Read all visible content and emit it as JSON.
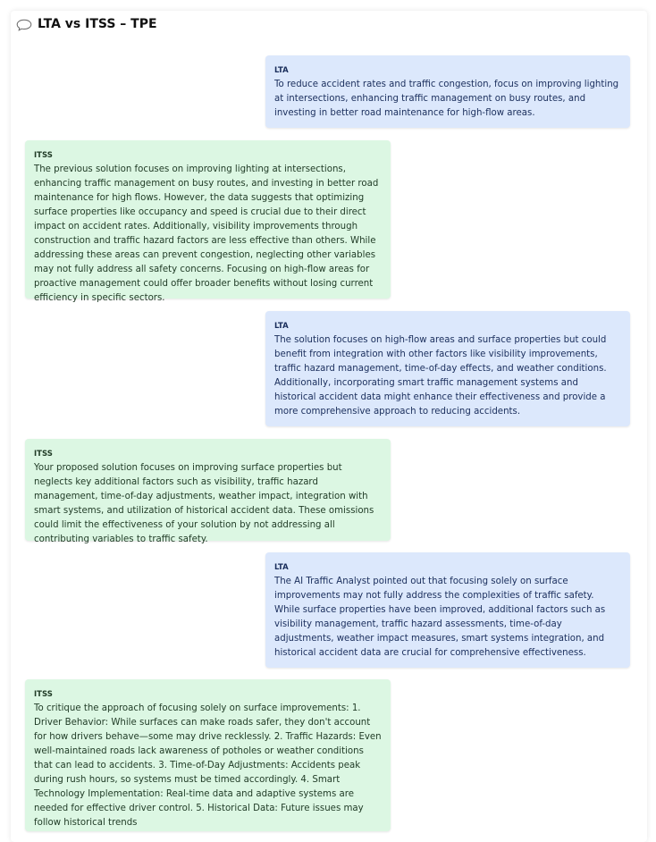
{
  "header": {
    "icon": "chat-bubble-icon",
    "title": "LTA vs ITSS – TPE"
  },
  "colors": {
    "lta_bubble": "#dce8fc",
    "itss_bubble": "#dcf7e3"
  },
  "messages": [
    {
      "speaker": "LTA",
      "text": "To reduce accident rates and traffic congestion, focus on improving lighting at intersections, enhancing traffic management on busy routes, and investing in better road maintenance for high-flow areas."
    },
    {
      "speaker": "ITSS",
      "text": "The previous solution focuses on improving lighting at intersections, enhancing traffic management on busy routes, and investing in better road maintenance for high flows. However, the data suggests that optimizing surface properties like occupancy and speed is crucial due to their direct impact on accident rates. Additionally, visibility improvements through construction and traffic hazard factors are less effective than others. While addressing these areas can prevent congestion, neglecting other variables may not fully address all safety concerns. Focusing on high-flow areas for proactive management could offer broader benefits without losing current efficiency in specific sectors."
    },
    {
      "speaker": "LTA",
      "text": "The solution focuses on high-flow areas and surface properties but could benefit from integration with other factors like visibility improvements, traffic hazard management, time-of-day effects, and weather conditions. Additionally, incorporating smart traffic management systems and historical accident data might enhance their effectiveness and provide a more comprehensive approach to reducing accidents."
    },
    {
      "speaker": "ITSS",
      "text": "Your proposed solution focuses on improving surface properties but neglects key additional factors such as visibility, traffic hazard management, time-of-day adjustments, weather impact, integration with smart systems, and utilization of historical accident data. These omissions could limit the effectiveness of your solution by not addressing all contributing variables to traffic safety."
    },
    {
      "speaker": "LTA",
      "text": "The AI Traffic Analyst pointed out that focusing solely on surface improvements may not fully address the complexities of traffic safety. While surface properties have been improved, additional factors such as visibility management, traffic hazard assessments, time-of-day adjustments, weather impact measures, smart systems integration, and historical accident data are crucial for comprehensive effectiveness."
    },
    {
      "speaker": "ITSS",
      "text": "To critique the approach of focusing solely on surface improvements: 1. Driver Behavior: While surfaces can make roads safer, they don't account for how drivers behave—some may drive recklessly. 2. Traffic Hazards: Even well-maintained roads lack awareness of potholes or weather conditions that can lead to accidents. 3. Time-of-Day Adjustments: Accidents peak during rush hours, so systems must be timed accordingly. 4. Smart Technology Implementation: Real-time data and adaptive systems are needed for effective driver control. 5. Historical Data: Future issues may follow historical trends"
    }
  ]
}
